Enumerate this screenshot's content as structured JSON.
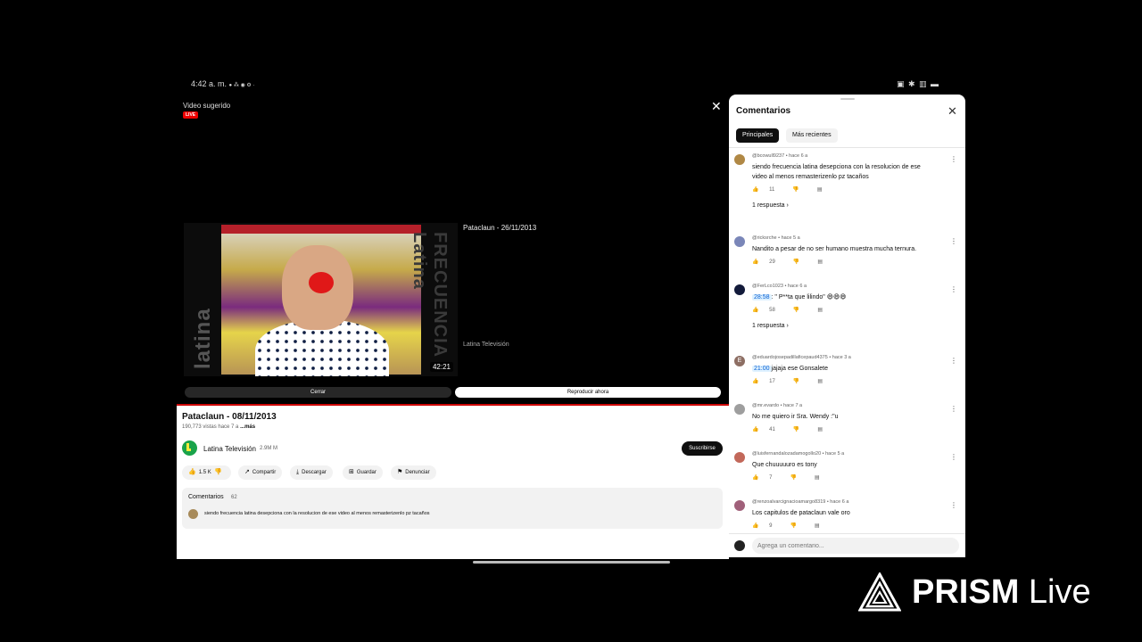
{
  "status_bar": {
    "time": "4:42 a. m.",
    "indicators": "● ⁂ ◉ ⚙ ·",
    "right_icons": "▣ ✱ ▥ ▬"
  },
  "overlay": {
    "label": "Video sugerido",
    "live_badge": "LIVE",
    "suggested": {
      "title": "Pataclaun - 26/11/2013",
      "channel": "Latina Televisión",
      "duration": "42:21",
      "thumb_brand_left": "latina",
      "thumb_brand_right": "FRECUENCIA Latina"
    },
    "close_button": "Cerrar",
    "play_button": "Reproducir ahora"
  },
  "video": {
    "title": "Pataclaun - 08/11/2013",
    "views": "190,773 vistas",
    "age": "hace 7 a",
    "more": "...más",
    "channel_name": "Latina Televisión",
    "channel_subs": "2.9M M",
    "subscribe_label": "Suscribirse",
    "actions": {
      "like_count": "1.5 K",
      "share": "Compartir",
      "download": "Descargar",
      "save": "Guardar",
      "report": "Denunciar"
    },
    "comments_preview": {
      "title": "Comentarios",
      "count": "62",
      "text": "siendo frecuencia latina desepciona con la resolucion de ese video al menos remasterizenlo pz tacaños"
    }
  },
  "comments_panel": {
    "title": "Comentarios",
    "tabs": [
      "Principales",
      "Más recientes"
    ],
    "input_placeholder": "Agrega un comentario...",
    "comments": [
      {
        "author": "@bcowull9237 • hace 6 a",
        "line1": "siendo frecuencia latina desepciona con la resolucion de ese",
        "line2": "video al menos remasterizenlo pz tacaños",
        "likes": "11",
        "replies": "1 respuesta",
        "avatar_color": "#b08845"
      },
      {
        "author": "@ricksrche • hace 5 a",
        "line1": "Nandito a pesar de no ser humano muestra mucha ternura.",
        "likes": "29",
        "avatar_color": "#7a86b8"
      },
      {
        "author": "@FerLco1023 • hace 6 a",
        "timestamp": "28:58",
        "line1": ": \" P**ta que lilindo\" 😄😄😄",
        "likes": "58",
        "replies": "1 respuesta",
        "avatar_color": "#121a3a"
      },
      {
        "author": "@eduardojosepadillaficepaud4375 • hace 3 a",
        "timestamp": "21:00",
        "line1": "jajaja ese Gonsalete",
        "likes": "17",
        "avatar_color": "#8d6e63",
        "avatar_letter": "E"
      },
      {
        "author": "@mr.evardo • hace 7 a",
        "line1": "No me quiero ir Sra. Wendy :\"u",
        "likes": "41",
        "avatar_color": "#9e9e9e"
      },
      {
        "author": "@luisfernandalozadamogollo20 • hace 5 a",
        "line1": "Que chuuuuuro es tony",
        "likes": "7",
        "avatar_color": "#c2685a"
      },
      {
        "author": "@renzoalvarcignacioamargo8319 • hace 6 a",
        "line1": "Los capitulos de pataclaun vale oro",
        "likes": "9",
        "avatar_color": "#a0607a"
      }
    ]
  },
  "watermark": {
    "brand": "PRISM",
    "suffix": "Live"
  }
}
